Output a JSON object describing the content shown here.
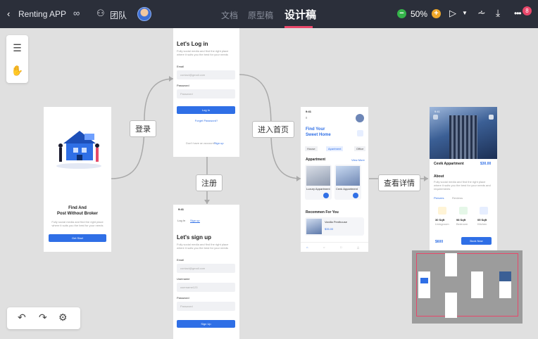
{
  "topbar": {
    "back_icon": "chevron-left-icon",
    "project_title": "Renting APP",
    "link_icon": "link-icon",
    "team_icon": "team-icon",
    "team_label": "团队",
    "tabs": [
      {
        "label": "文档"
      },
      {
        "label": "原型稿"
      },
      {
        "label": "设计稿"
      }
    ],
    "zoom": "50%",
    "notification_count": "8",
    "accent_color": "#e8476a",
    "bg_color": "#2b2f3a"
  },
  "flow_labels": {
    "login": "登录",
    "register": "注册",
    "enter_home": "进入首页",
    "view_details": "查看详情"
  },
  "screens": {
    "splash": {
      "title_line1": "Find And",
      "title_line2": "Post Without Broker",
      "subtitle": "Fully social media and find the right place where it suits you the best for your needs",
      "button": "Get Start"
    },
    "login": {
      "title": "Let's Log in",
      "subtitle": "Fully social media and find the right place where it suits you the best for your needs",
      "email_label": "Email",
      "email_placeholder": "contact@gmail.com",
      "password_label": "Password",
      "password_placeholder": "Password",
      "button": "Log In",
      "forgot": "Forget Password?",
      "no_account": "Don't have an account?",
      "sign_up_link": "Sign up"
    },
    "signup": {
      "time": "9:41",
      "tab_login": "Log In",
      "tab_signup": "Sign up",
      "title": "Let's sign up",
      "subtitle": "Fully social media and find the right place where it suits you the best for your needs",
      "email_label": "Email",
      "email_placeholder": "contact@gmail.com",
      "username_label": "Username",
      "username_placeholder": "username123",
      "password_label": "Password",
      "password_placeholder": "Password",
      "button": "Sign Up"
    },
    "home": {
      "time": "9:41",
      "title_line1": "Find Your",
      "title_line2": "Sweet Home",
      "chips": [
        "House",
        "Apartment",
        "Office"
      ],
      "section_apartment": "Appartment",
      "view_all": "View More",
      "card1_title": "Luxury Appartment",
      "card2_title": "Cenk Appartment",
      "section_recommend": "Recommen For You",
      "rec_title": "Vanilla Penthouse",
      "rec_price": "$35.00"
    },
    "detail": {
      "time": "9:41",
      "name": "Cevik Appartment",
      "price": "$30.00",
      "about": "About",
      "about_text": "Fully social media and find the right place where it suits you the best for your needs and requirements",
      "tab_pictures": "Pictures",
      "tab_reviews": "Reviews",
      "feat1_value": "30 Sqft",
      "feat1_label": "Livingroom",
      "feat2_value": "98 Sqft",
      "feat2_label": "Bedroom",
      "feat3_value": "05 Sqft",
      "feat3_label": "Kitchen",
      "bottom_price": "$600",
      "book_button": "Book Now"
    }
  }
}
